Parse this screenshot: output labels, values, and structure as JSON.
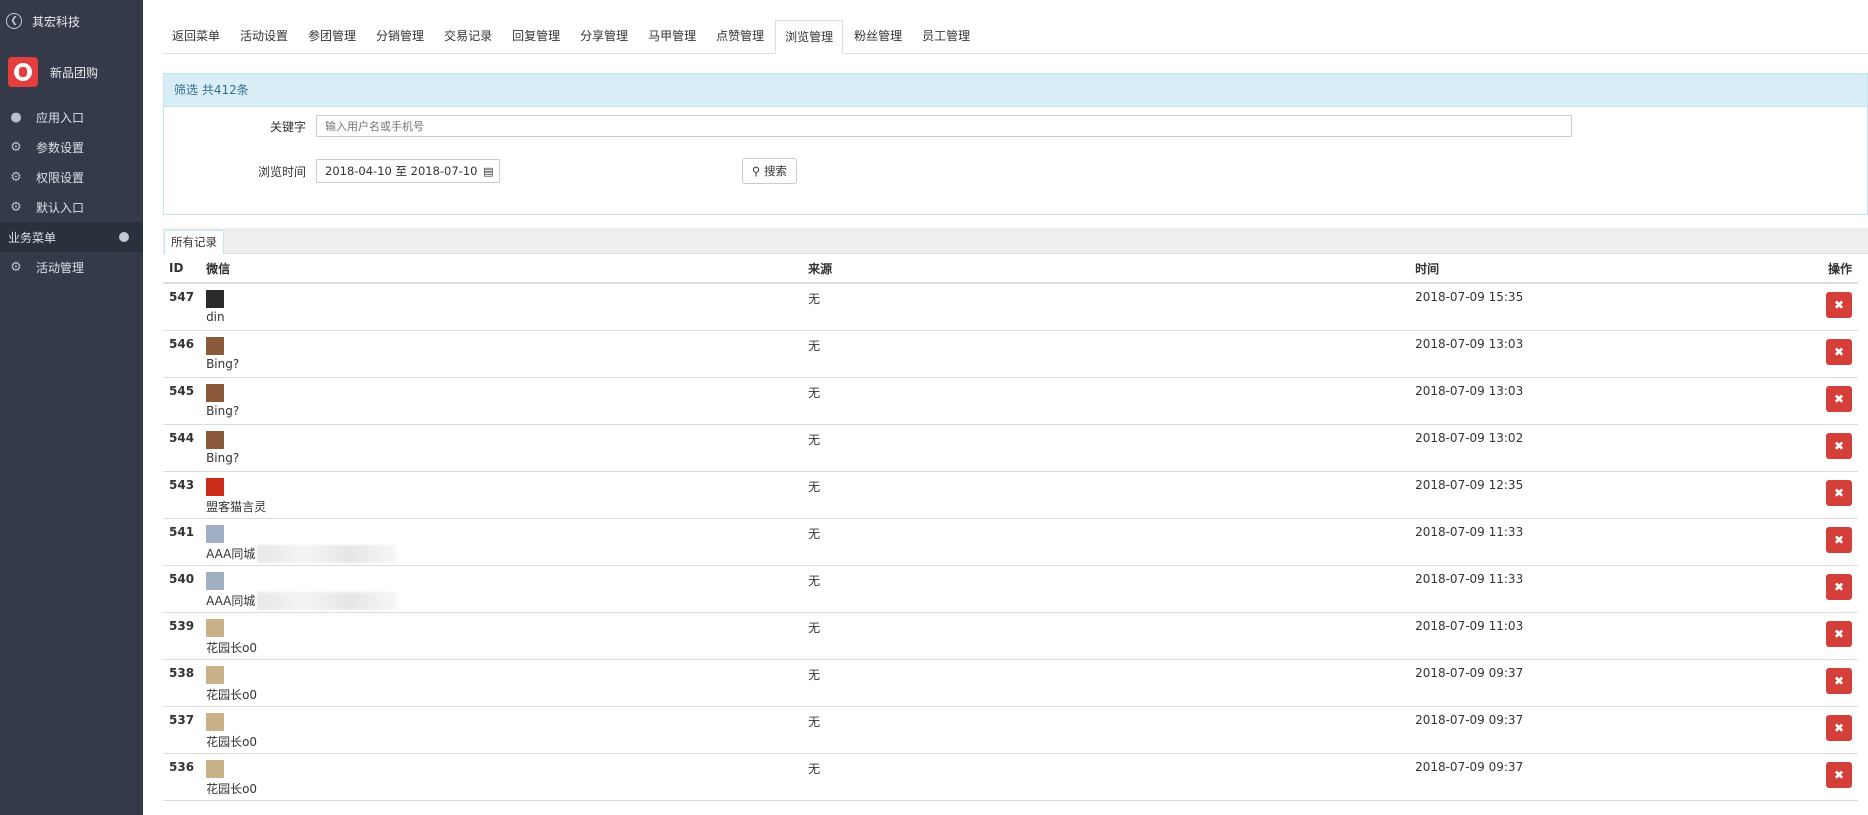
{
  "sidebar": {
    "back_label": "其宏科技",
    "brand": "新品团购",
    "items": [
      {
        "label": "应用入口",
        "icon": "chat-icon"
      },
      {
        "label": "参数设置",
        "icon": "gear-icon"
      },
      {
        "label": "权限设置",
        "icon": "gear-icon"
      },
      {
        "label": "默认入口",
        "icon": "gear-icon"
      }
    ],
    "section_label": "业务菜单",
    "section_items": [
      {
        "label": "活动管理",
        "icon": "gear-icon"
      }
    ]
  },
  "tabs": [
    "返回菜单",
    "活动设置",
    "参团管理",
    "分销管理",
    "交易记录",
    "回复管理",
    "分享管理",
    "马甲管理",
    "点赞管理",
    "浏览管理",
    "粉丝管理",
    "员工管理"
  ],
  "active_tab": "浏览管理",
  "filter": {
    "header": "筛选 共412条",
    "keyword_label": "关键字",
    "keyword_placeholder": "输入用户名或手机号",
    "date_label": "浏览时间",
    "date_range": "2018-04-10 至 2018-07-10",
    "search_label": "搜索"
  },
  "records_tab": "所有记录",
  "table": {
    "headers": [
      "ID",
      "微信",
      "来源",
      "时间",
      "操作"
    ],
    "rows": [
      {
        "id": "547",
        "nick": "din",
        "source": "无",
        "time": "2018-07-09 15:35",
        "avatar_color": "#2b2b2b"
      },
      {
        "id": "546",
        "nick": "Bing?",
        "source": "无",
        "time": "2018-07-09 13:03",
        "avatar_color": "#8a5a3a"
      },
      {
        "id": "545",
        "nick": "Bing?",
        "source": "无",
        "time": "2018-07-09 13:03",
        "avatar_color": "#8a5a3a"
      },
      {
        "id": "544",
        "nick": "Bing?",
        "source": "无",
        "time": "2018-07-09 13:02",
        "avatar_color": "#8a5a3a"
      },
      {
        "id": "543",
        "nick": "盟客猫言灵",
        "source": "无",
        "time": "2018-07-09 12:35",
        "avatar_color": "#cc2a1a"
      },
      {
        "id": "541",
        "nick": "AAA同城",
        "source": "无",
        "time": "2018-07-09 11:33",
        "avatar_color": "#9fb0c4"
      },
      {
        "id": "540",
        "nick": "AAA同城",
        "source": "无",
        "time": "2018-07-09 11:33",
        "avatar_color": "#9fb0c4"
      },
      {
        "id": "539",
        "nick": "花园长o0",
        "source": "无",
        "time": "2018-07-09 11:03",
        "avatar_color": "#c9b28a"
      },
      {
        "id": "538",
        "nick": "花园长o0",
        "source": "无",
        "time": "2018-07-09 09:37",
        "avatar_color": "#c9b28a"
      },
      {
        "id": "537",
        "nick": "花园长o0",
        "source": "无",
        "time": "2018-07-09 09:37",
        "avatar_color": "#c9b28a"
      },
      {
        "id": "536",
        "nick": "花园长o0",
        "source": "无",
        "time": "2018-07-09 09:37",
        "avatar_color": "#c9b28a"
      }
    ],
    "delete_icon": "times-icon"
  },
  "colors": {
    "sidebar_bg": "#343a4a",
    "filter_header_bg": "#d9edf7",
    "delete_btn": "#d43f3a"
  }
}
